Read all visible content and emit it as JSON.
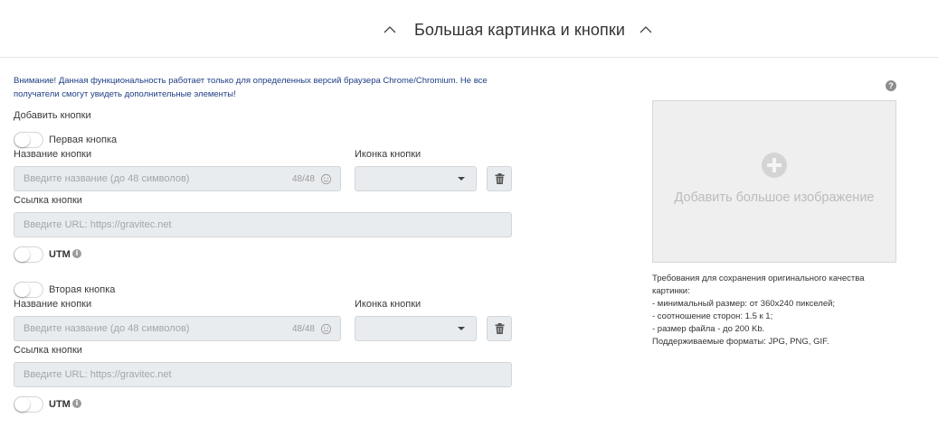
{
  "header": {
    "title": "Большая картинка и кнопки"
  },
  "warning": "Внимание! Данная функциональность работает только для определенных версий браузера Chrome/Chromium. Не все получатели смогут увидеть дополнительные элементы!",
  "add_buttons_label": "Добавить кнопки",
  "buttons": [
    {
      "toggle_label": "Первая кнопка",
      "name_label": "Название кнопки",
      "name_placeholder": "Введите название (до 48 символов)",
      "counter": "48/48",
      "icon_label": "Иконка кнопки",
      "link_label": "Ссылка кнопки",
      "link_placeholder": "Введите URL: https://gravitec.net",
      "utm_label": "UTM"
    },
    {
      "toggle_label": "Вторая кнопка",
      "name_label": "Название кнопки",
      "name_placeholder": "Введите название (до 48 символов)",
      "counter": "48/48",
      "icon_label": "Иконка кнопки",
      "link_label": "Ссылка кнопки",
      "link_placeholder": "Введите URL: https://gravitec.net",
      "utm_label": "UTM"
    }
  ],
  "image_panel": {
    "help": "?",
    "upload_text": "Добавить большое изображение",
    "requirements": [
      "Требования для сохранения оригинального качества картинки:",
      "- минимальный размер: от 360x240 пикселей;",
      "- соотношение сторон: 1.5 к 1;",
      "- размер файла - до 200 Kb.",
      "Поддерживаемые форматы: JPG, PNG, GIF."
    ]
  },
  "icons": {
    "collapse": "chevron-up-icon",
    "smile": "smile-icon",
    "delete": "trash-icon",
    "info": "info-icon",
    "help": "question-icon",
    "add_image": "plus-circle-icon"
  },
  "colors": {
    "warning_text": "#1f3e84",
    "field_bg": "#e9ecef",
    "upload_bg": "#efefef"
  }
}
